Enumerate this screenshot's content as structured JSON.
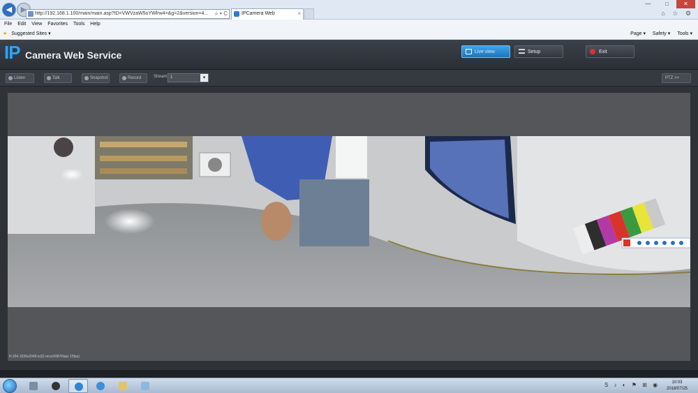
{
  "browser": {
    "address": "http://192.168.1.100/main/main.asp?ID=VWVzaW5oYWlrw4=&g=2&version=4...",
    "address_actions": "⌕ ▾ C",
    "tab_title": "IPCamera Web",
    "tab_close": "×",
    "back_glyph": "◀",
    "forward_glyph": "▶",
    "window_controls": [
      "—",
      "□",
      "✕"
    ],
    "toolbar_icons": "⌂ ☆ ⚙",
    "menu": [
      "File",
      "Edit",
      "View",
      "Favorites",
      "Tools",
      "Help"
    ],
    "suggested_sites": "Suggested Sites ▾",
    "command_bar": [
      "Page ▾",
      "Safety ▾",
      "Tools ▾"
    ]
  },
  "app": {
    "logo_ip": "IP",
    "logo_text": "Camera Web Service",
    "nav": {
      "live_view": "Live view",
      "setup": "Setup",
      "exit": "Exit"
    }
  },
  "toolbar": {
    "listen": "Listen",
    "talk": "Talk",
    "snapshot": "Snapshot",
    "record": "Record",
    "stream_label": "Stream",
    "stream_value": "1",
    "ptz": "PTZ >>"
  },
  "video": {
    "status": "H.264 1536x2048 ic(0) recv(4387Kbps 15fps)"
  },
  "taskbar": {
    "clock_time": "10:03",
    "clock_date": "2018/07/25",
    "tray_icons": "S ♪ ◐ ⚑ ⊞ ◉"
  },
  "colors": {
    "accent": "#2aa5ff",
    "live_view_active": "#1c74b8",
    "exit_icon": "#d9342b"
  }
}
